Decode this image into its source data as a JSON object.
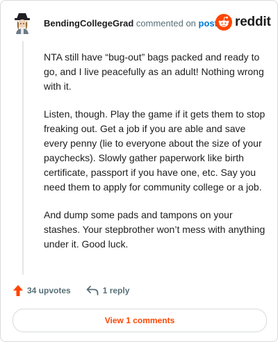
{
  "header": {
    "username": "BendingCollegeGrad",
    "commented_text": "commented on",
    "post_link": "post"
  },
  "brand": {
    "wordmark": "reddit",
    "accent_color": "#ff4500"
  },
  "comment": {
    "paragraphs": [
      "NTA still have “bug-out” bags packed and ready to go, and I live peacefully as an adult! Nothing wrong with it.",
      "Listen, though. Play the game if it gets them to stop freaking out. Get a job if you are able and save every penny (lie to everyone about the size of your paychecks). Slowly gather paperwork like birth certificate, passport if you have one, etc. Say you need them to apply for community college or a job.",
      "And dump some pads and tampons on your stashes. Your stepbrother won’t mess with anything under it. Good luck."
    ]
  },
  "actions": {
    "upvotes": "34 upvotes",
    "replies": "1 reply"
  },
  "view_button": {
    "label": "View 1 comments"
  },
  "icons": {
    "avatar": "avatar-icon",
    "snoo": "reddit-snoo-icon",
    "upvote": "upvote-arrow-icon",
    "reply": "reply-arrow-icon"
  }
}
